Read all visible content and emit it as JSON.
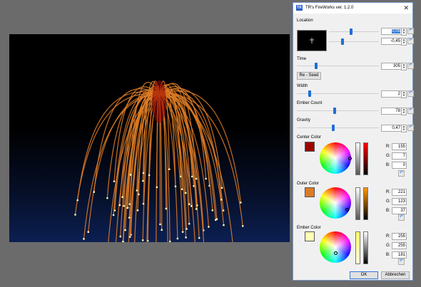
{
  "window": {
    "title": "TR's FireWorks ver. 1.2.0",
    "app_icon": "TR"
  },
  "location": {
    "label": "Location",
    "x_value": "0,05",
    "y_value": "-0,45"
  },
  "time": {
    "label": "Time",
    "value": "305",
    "reseed_label": "Re - Seed"
  },
  "width": {
    "label": "Width",
    "value": "2"
  },
  "ember_count": {
    "label": "Ember Count",
    "value": "78"
  },
  "gravity": {
    "label": "Gravity",
    "value": "0,47"
  },
  "center_color": {
    "label": "Center Color",
    "hex": "#9b0700",
    "r": "155",
    "g": "7",
    "b": "0"
  },
  "outer_color": {
    "label": "Outer Color",
    "hex": "#dd7b25",
    "r": "221",
    "g": "123",
    "b": "37"
  },
  "ember_color": {
    "label": "Ember Color",
    "hex": "#ffffb5",
    "r": "255",
    "g": "255",
    "b": "181"
  },
  "rgb_labels": {
    "r": "R:",
    "g": "G:",
    "b": "B:"
  },
  "buttons": {
    "ok": "OK",
    "cancel": "Abbrechen",
    "close_glyph": "✕"
  }
}
